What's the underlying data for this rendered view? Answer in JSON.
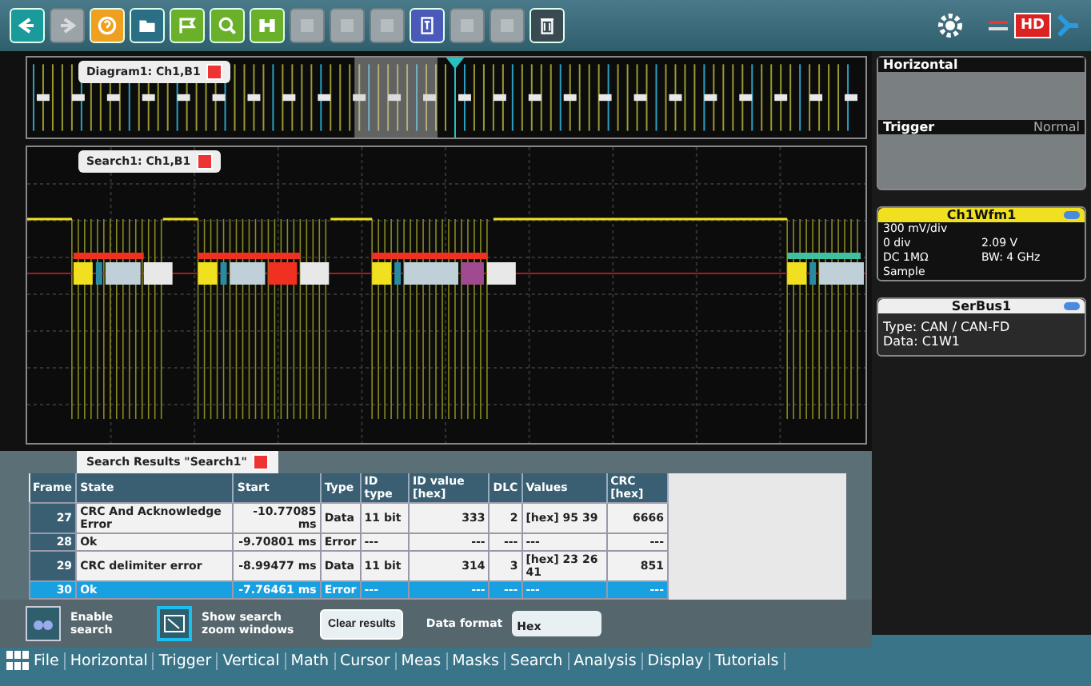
{
  "toolbar": {
    "left": [
      {
        "kind": "back",
        "color": "#1a9a9a",
        "disabled": false
      },
      {
        "kind": "forward",
        "color": "#9aa4a8",
        "disabled": true
      },
      {
        "kind": "help",
        "color": "#f0a020",
        "disabled": false
      },
      {
        "kind": "open",
        "color": "#2a6f86",
        "disabled": false
      },
      {
        "kind": "save",
        "color": "#6ab02a",
        "disabled": false
      },
      {
        "kind": "zoom",
        "color": "#6ab02a",
        "disabled": false
      },
      {
        "kind": "find",
        "color": "#6ab02a",
        "disabled": false
      },
      {
        "kind": "blank",
        "color": "#9aa4a8",
        "disabled": true
      },
      {
        "kind": "blank",
        "color": "#9aa4a8",
        "disabled": true
      },
      {
        "kind": "blank",
        "color": "#9aa4a8",
        "disabled": true
      },
      {
        "kind": "doc",
        "color": "#4a5ab8",
        "disabled": false
      },
      {
        "kind": "blank",
        "color": "#9aa4a8",
        "disabled": true
      },
      {
        "kind": "blank",
        "color": "#9aa4a8",
        "disabled": true
      },
      {
        "kind": "trash",
        "color": "#3a4a52",
        "disabled": false
      }
    ],
    "hd_label": "HD"
  },
  "overview": {
    "tab": "Diagram1: Ch1,B1"
  },
  "zoom_window": {
    "tab": "Search1: Ch1,B1"
  },
  "results": {
    "tab": "Search Results \"Search1\"",
    "columns": [
      "Frame",
      "State",
      "Start",
      "Type",
      "ID type",
      "ID value [hex]",
      "DLC",
      "Values",
      "CRC [hex]"
    ],
    "rows": [
      {
        "cells": [
          "27",
          "CRC And Acknowledge Error",
          "-10.77085 ms",
          "Data",
          "11 bit",
          "333",
          "2",
          "[hex] 95 39",
          "6666"
        ],
        "selected": false
      },
      {
        "cells": [
          "28",
          "Ok",
          "-9.70801 ms",
          "Error",
          "---",
          "---",
          "---",
          "---",
          "---"
        ],
        "selected": false
      },
      {
        "cells": [
          "29",
          "CRC delimiter error",
          "-8.99477 ms",
          "Data",
          "11 bit",
          "314",
          "3",
          "[hex] 23 26 41",
          "851"
        ],
        "selected": false
      },
      {
        "cells": [
          "30",
          "Ok",
          "-7.76461 ms",
          "Error",
          "---",
          "---",
          "---",
          "---",
          "---"
        ],
        "selected": true
      }
    ]
  },
  "controls": {
    "enable_search": "Enable search",
    "show_zoom": "Show search zoom windows",
    "clear": "Clear results",
    "format_label": "Data format",
    "format_value": "Hex"
  },
  "side_panel": {
    "horizontal": {
      "title": "Horizontal"
    },
    "trigger": {
      "title": "Trigger",
      "mode": "Normal"
    },
    "channel": {
      "title": "Ch1Wfm1",
      "lines": [
        [
          "300 mV/div"
        ],
        [
          "0 div",
          "2.09 V"
        ],
        [
          "DC 1MΩ",
          "BW: 4 GHz"
        ],
        [
          "Sample"
        ]
      ]
    },
    "bus": {
      "title": "SerBus1",
      "lines": [
        "Type: CAN / CAN-FD",
        "Data: C1W1"
      ]
    }
  },
  "menu": [
    "File",
    "Horizontal",
    "Trigger",
    "Vertical",
    "Math",
    "Cursor",
    "Meas",
    "Masks",
    "Search",
    "Analysis",
    "Display",
    "Tutorials"
  ]
}
